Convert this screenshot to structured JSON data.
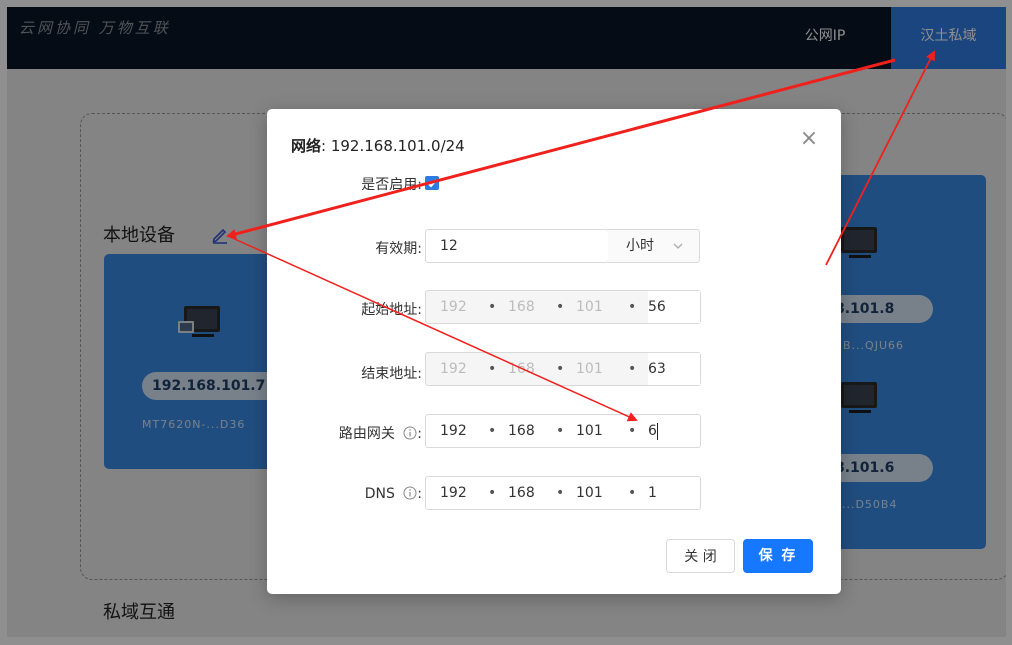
{
  "header": {
    "slogan": "云网协同  万物互联",
    "nav": [
      {
        "label": "公网IP"
      },
      {
        "label": "汉土私域"
      }
    ]
  },
  "main": {
    "local_devices_title": "本地设备",
    "private_interconnect_title": "私域互通",
    "devices": [
      {
        "ip": "192.168.101.7",
        "mac": "MT7620N-...D36"
      },
      {
        "ip": "8.101.8",
        "mac": "B...QJU66"
      },
      {
        "ip": "8.101.6",
        "mac": "-...D50B4"
      }
    ]
  },
  "modal": {
    "title_label": "网络",
    "title_value": ": 192.168.101.0/24",
    "enable_label": "是否启用:",
    "enabled": true,
    "validity_label": "有效期:",
    "validity_value": "12",
    "validity_unit": "小时",
    "start_label": "起始地址:",
    "start": {
      "a": "192",
      "b": "168",
      "c": "101",
      "d": "56"
    },
    "end_label": "结束地址:",
    "end": {
      "a": "192",
      "b": "168",
      "c": "101",
      "d": "63"
    },
    "gateway_label": "路由网关",
    "gateway": {
      "a": "192",
      "b": "168",
      "c": "101",
      "d": "6"
    },
    "dns_label": "DNS",
    "dns": {
      "a": "192",
      "b": "168",
      "c": "101",
      "d": "1"
    },
    "info_suffix": ":",
    "close_label": "关 闭",
    "save_label": "保 存"
  },
  "colors": {
    "topbar": "#0b1626",
    "nav_active": "#2f7ce0",
    "card": "#3a89e2",
    "primary_button": "#1677ff",
    "arrow": "#f0201c"
  },
  "icons": [
    "pencil-edit-icon",
    "device-computer-icon",
    "close-x-icon",
    "checkmark-icon",
    "info-circle-icon",
    "chevron-down-icon"
  ]
}
